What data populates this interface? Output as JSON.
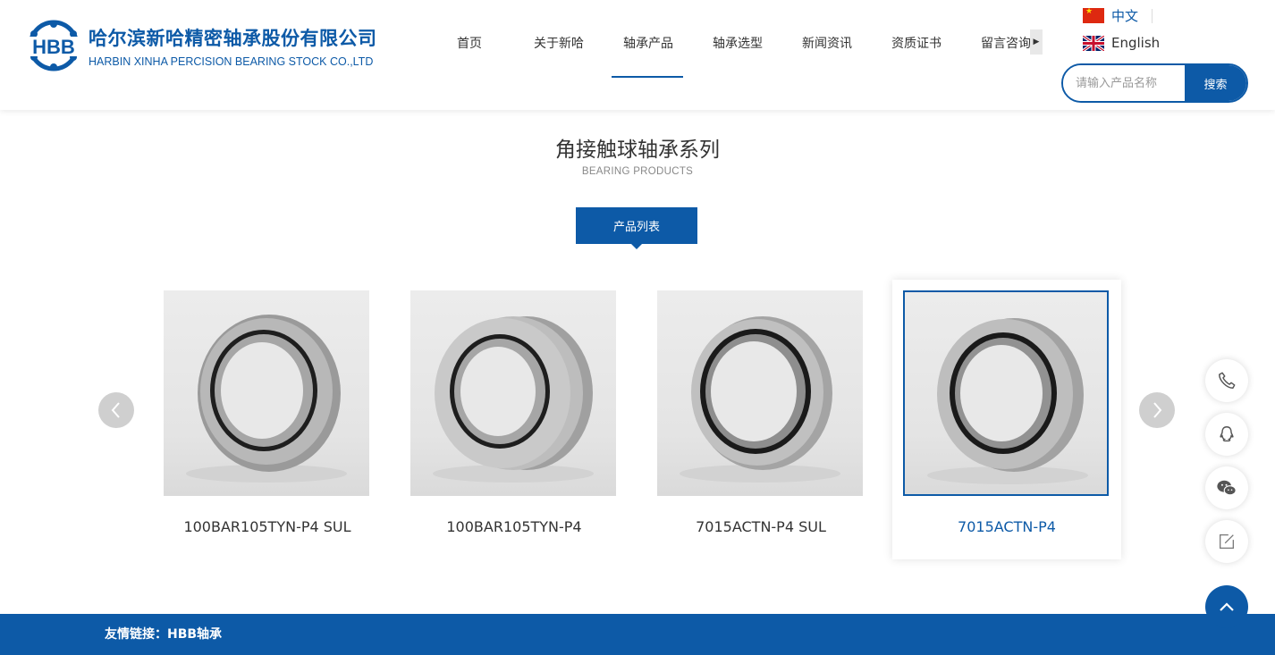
{
  "brand": {
    "logo_text": "HBB",
    "name_cn": "哈尔滨新哈精密轴承股份有限公司",
    "name_en": "HARBIN XINHA PERCISION BEARING STOCK CO.,LTD",
    "color": "#0d5aa7"
  },
  "nav": {
    "items": [
      {
        "label": "首页"
      },
      {
        "label": "关于新哈"
      },
      {
        "label": "轴承产品"
      },
      {
        "label": "轴承选型"
      },
      {
        "label": "新闻资讯"
      },
      {
        "label": "资质证书"
      },
      {
        "label": "留言咨询"
      }
    ],
    "active_index": 2
  },
  "languages": {
    "chinese": "中文",
    "english": "English"
  },
  "search": {
    "placeholder": "请输入产品名称",
    "button": "搜索"
  },
  "section": {
    "title": "角接触球轴承系列",
    "subtitle": "BEARING PRODUCTS",
    "tab": "产品列表"
  },
  "products": [
    {
      "label": "100BAR105TYN-P4 SUL"
    },
    {
      "label": "100BAR105TYN-P4"
    },
    {
      "label": "7015ACTN-P4 SUL"
    },
    {
      "label": "7015ACTN-P4"
    }
  ],
  "active_product_index": 3,
  "float_icons": [
    "phone-icon",
    "qq-icon",
    "wechat-icon",
    "feedback-icon"
  ],
  "footer": {
    "links_label": "友情链接：",
    "link": "HBB轴承"
  }
}
